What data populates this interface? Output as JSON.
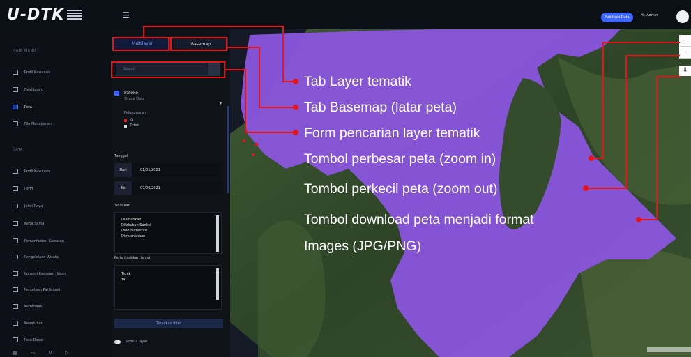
{
  "app": {
    "logo_text": "U-DTK",
    "menu_icon": "menu-icon",
    "header_button": "Publikasi Data",
    "user_name": "Hi, Admin"
  },
  "sidebar": {
    "section1": "MAIN MENU",
    "section2": "DATA",
    "items": [
      {
        "label": "Profil Kawasan",
        "icon": "list-icon"
      },
      {
        "label": "Dashboard",
        "icon": "dashboard-icon"
      },
      {
        "label": "Peta",
        "icon": "map-icon",
        "active": true
      },
      {
        "label": "File Manajemen",
        "icon": "folder-icon"
      },
      {
        "label": "Profil Kawasan",
        "icon": "list-icon"
      },
      {
        "label": "HRTT",
        "icon": "list-icon"
      },
      {
        "label": "Jalan Raya",
        "icon": "list-icon"
      },
      {
        "label": "Kerja Sama",
        "icon": "list-icon"
      },
      {
        "label": "Pemanfaatan Kawasan",
        "icon": "list-icon"
      },
      {
        "label": "Pengelolaan Wisata",
        "icon": "list-icon"
      },
      {
        "label": "Konsesi Kawasan Hutan",
        "icon": "list-icon"
      },
      {
        "label": "Pemetaan Partisipatif",
        "icon": "list-icon"
      },
      {
        "label": "Kemitraan",
        "icon": "list-icon"
      },
      {
        "label": "Kepatuhan",
        "icon": "list-icon"
      },
      {
        "label": "Peta Dasar",
        "icon": "list-icon"
      }
    ]
  },
  "layer_panel": {
    "tab_layer": "Multilayer",
    "tab_basemap": "Basemap",
    "search_placeholder": "Search",
    "layer_name": "Patoko",
    "layer_sub": "Shape Data",
    "legend_title": "Pelanggaran",
    "legend_items": [
      "Ya",
      "Tidak"
    ],
    "date_label": "Tanggal",
    "from_label": "Dari",
    "from_value": "01/01/2021",
    "to_label": "Ke",
    "to_value": "07/06/2021",
    "status_label": "Tindakan",
    "status_options": [
      "Diamankan",
      "Dilakukan Sanksi",
      "Didokumentasi",
      "Dimusnahkan"
    ],
    "kind_label": "Perlu tindakan lanjut",
    "kind_options": [
      "Tidak",
      "Ya"
    ],
    "apply_button": "Terapkan filter",
    "toggle_label": "Semua layer"
  },
  "annotations": [
    "Tab Layer tematik",
    "Tab Basemap (latar peta)",
    "Form pencarian layer tematik",
    "Tombol perbesar peta (zoom in)",
    "Tombol perkecil peta (zoom out)",
    "Tombol download peta menjadi format",
    "Images (JPG/PNG)"
  ],
  "map_controls": {
    "zoom_in": "+",
    "zoom_out": "−",
    "download": "⬇"
  },
  "colors": {
    "overlay": "#8a55dd",
    "callout": "#e3151b",
    "accent": "#3c66ff"
  }
}
